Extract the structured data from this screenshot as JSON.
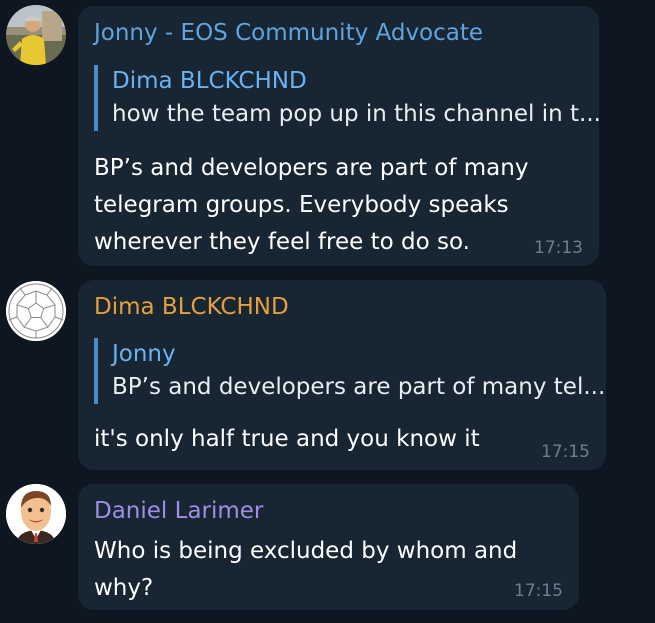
{
  "colors": {
    "background": "#0e1621",
    "bubble": "#182533",
    "reply_bar": "#4e8cc9",
    "timestamp": "#6d7f8f"
  },
  "messages": [
    {
      "author": "Jonny - EOS Community Advocate",
      "author_color": "#5ea5e0",
      "avatar_icon": "person-photo-avatar",
      "reply": {
        "author": "Dima BLCKCHND",
        "text": "how the team pop up in this channel in t..."
      },
      "text": "BP’s and developers are part of many\ntelegram groups.  Everybody speaks\nwherever they feel free to do so.",
      "time": "17:13"
    },
    {
      "author": "Dima BLCKCHND",
      "author_color": "#e5a03b",
      "avatar_icon": "geodesic-ball-avatar",
      "reply": {
        "author": "Jonny",
        "text": "BP’s and developers are part of many tel..."
      },
      "text": "it's only half true and you know it",
      "time": "17:15"
    },
    {
      "author": "Daniel Larimer",
      "author_color": "#9e8ee4",
      "avatar_icon": "cartoon-face-avatar",
      "text": "Who is being excluded by whom and why?",
      "time": "17:15"
    }
  ]
}
